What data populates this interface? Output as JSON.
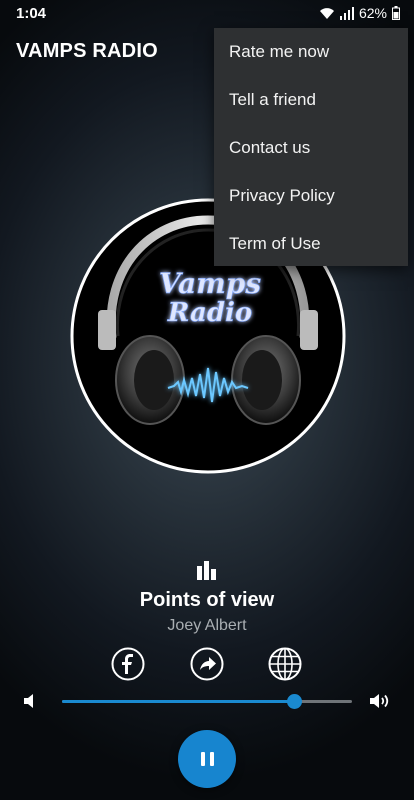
{
  "status": {
    "time": "1:04",
    "battery": "62%"
  },
  "app": {
    "title": "VAMPS RADIO"
  },
  "menu": {
    "items": [
      {
        "label": "Rate me now"
      },
      {
        "label": "Tell a friend"
      },
      {
        "label": "Contact us"
      },
      {
        "label": "Privacy Policy"
      },
      {
        "label": "Term of Use"
      }
    ]
  },
  "artwork": {
    "logo_line1": "Vamps",
    "logo_line2": "Radio"
  },
  "now_playing": {
    "title": "Points of view",
    "artist": "Joey Albert"
  },
  "player": {
    "volume": 0.8,
    "state": "playing"
  },
  "icons": {
    "share": [
      "facebook-icon",
      "share-icon",
      "globe-icon"
    ],
    "volume": [
      "volume-low-icon",
      "volume-high-icon"
    ],
    "control": "pause-icon"
  },
  "colors": {
    "accent": "#1785cf",
    "menu_bg": "#2e3032",
    "artist_text": "#a9aeb2"
  }
}
